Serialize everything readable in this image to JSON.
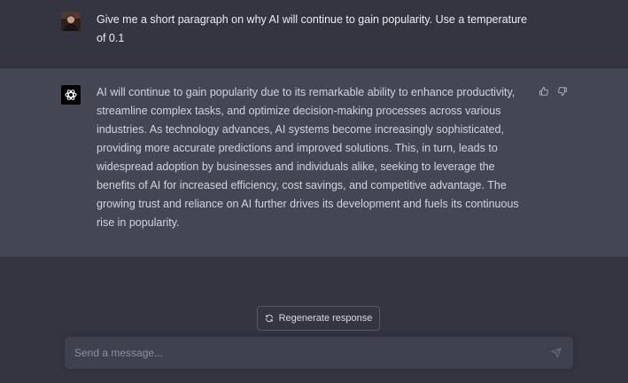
{
  "conversation": {
    "user_message": "Give me a short paragraph on why AI will continue to gain popularity. Use a temperature of 0.1",
    "assistant_message": "AI will continue to gain popularity due to its remarkable ability to enhance productivity, streamline complex tasks, and optimize decision-making processes across various industries. As technology advances, AI systems become increasingly sophisticated, providing more accurate predictions and improved solutions. This, in turn, leads to widespread adoption by businesses and individuals alike, seeking to leverage the benefits of AI for increased efficiency, cost savings, and competitive advantage. The growing trust and reliance on AI further drives its development and fuels its continuous rise in popularity."
  },
  "actions": {
    "regenerate_label": "Regenerate response"
  },
  "composer": {
    "placeholder": "Send a message...",
    "value": ""
  },
  "icons": {
    "user_avatar": "user-avatar-photo",
    "assistant_avatar": "openai-logo-icon",
    "thumbs_up": "thumbs-up-icon",
    "thumbs_down": "thumbs-down-icon",
    "regenerate": "refresh-icon",
    "send": "paper-plane-icon"
  },
  "colors": {
    "page_background": "#343541",
    "assistant_background": "#444654",
    "composer_background": "#40414f",
    "text_primary": "#ececf1",
    "text_assistant": "#d1d5db",
    "placeholder": "#8e8ea0"
  }
}
